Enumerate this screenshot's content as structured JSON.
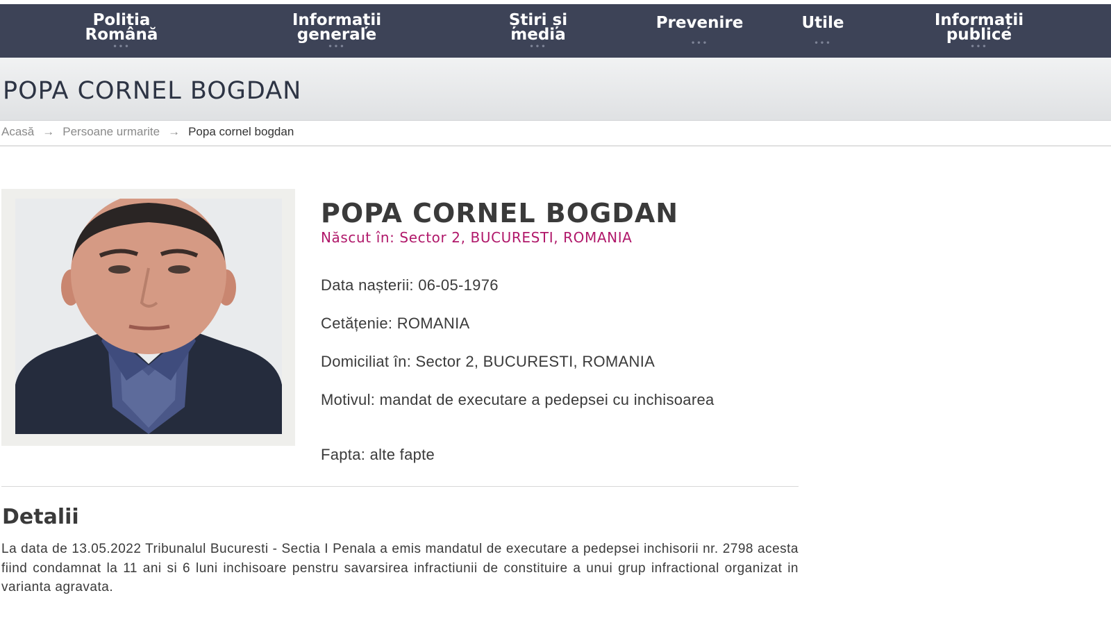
{
  "nav": {
    "items": [
      {
        "line1": "Poliția",
        "line2": "Română"
      },
      {
        "line1": "Informații",
        "line2": "generale"
      },
      {
        "line1": "Știri și",
        "line2": "media"
      },
      {
        "line1": "Prevenire",
        "line2": ""
      },
      {
        "line1": "Utile",
        "line2": ""
      },
      {
        "line1": "Informații",
        "line2": "publice"
      }
    ],
    "dots": "•••"
  },
  "page_title": "POPA CORNEL BOGDAN",
  "breadcrumb": {
    "items": [
      "Acasă",
      "Persoane urmarite",
      "Popa cornel bogdan"
    ],
    "separator": "→"
  },
  "person": {
    "name": "POPA CORNEL BOGDAN",
    "born": "Născut în: Sector 2, BUCURESTI, ROMANIA",
    "birth_date": "Data nașterii: 06-05-1976",
    "citizenship": "Cetățenie: ROMANIA",
    "domicile": "Domiciliat în: Sector 2, BUCURESTI, ROMANIA",
    "reason": "Motivul: mandat de executare a pedepsei cu inchisoarea",
    "deed": "Fapta: alte fapte"
  },
  "details": {
    "heading": "Detalii",
    "text": "La data de 13.05.2022 Tribunalul Bucuresti - Sectia I Penala a emis mandatul de executare a pedepsei inchisorii nr. 2798 acesta fiind condamnat la 11 ani si 6 luni inchisoare penstru savarsirea infractiunii de constituire a unui grup infractional organizat in varianta agravata."
  },
  "colors": {
    "nav_bg": "#3d4357",
    "accent_magenta": "#b0186a",
    "title_text": "#2d3444"
  }
}
